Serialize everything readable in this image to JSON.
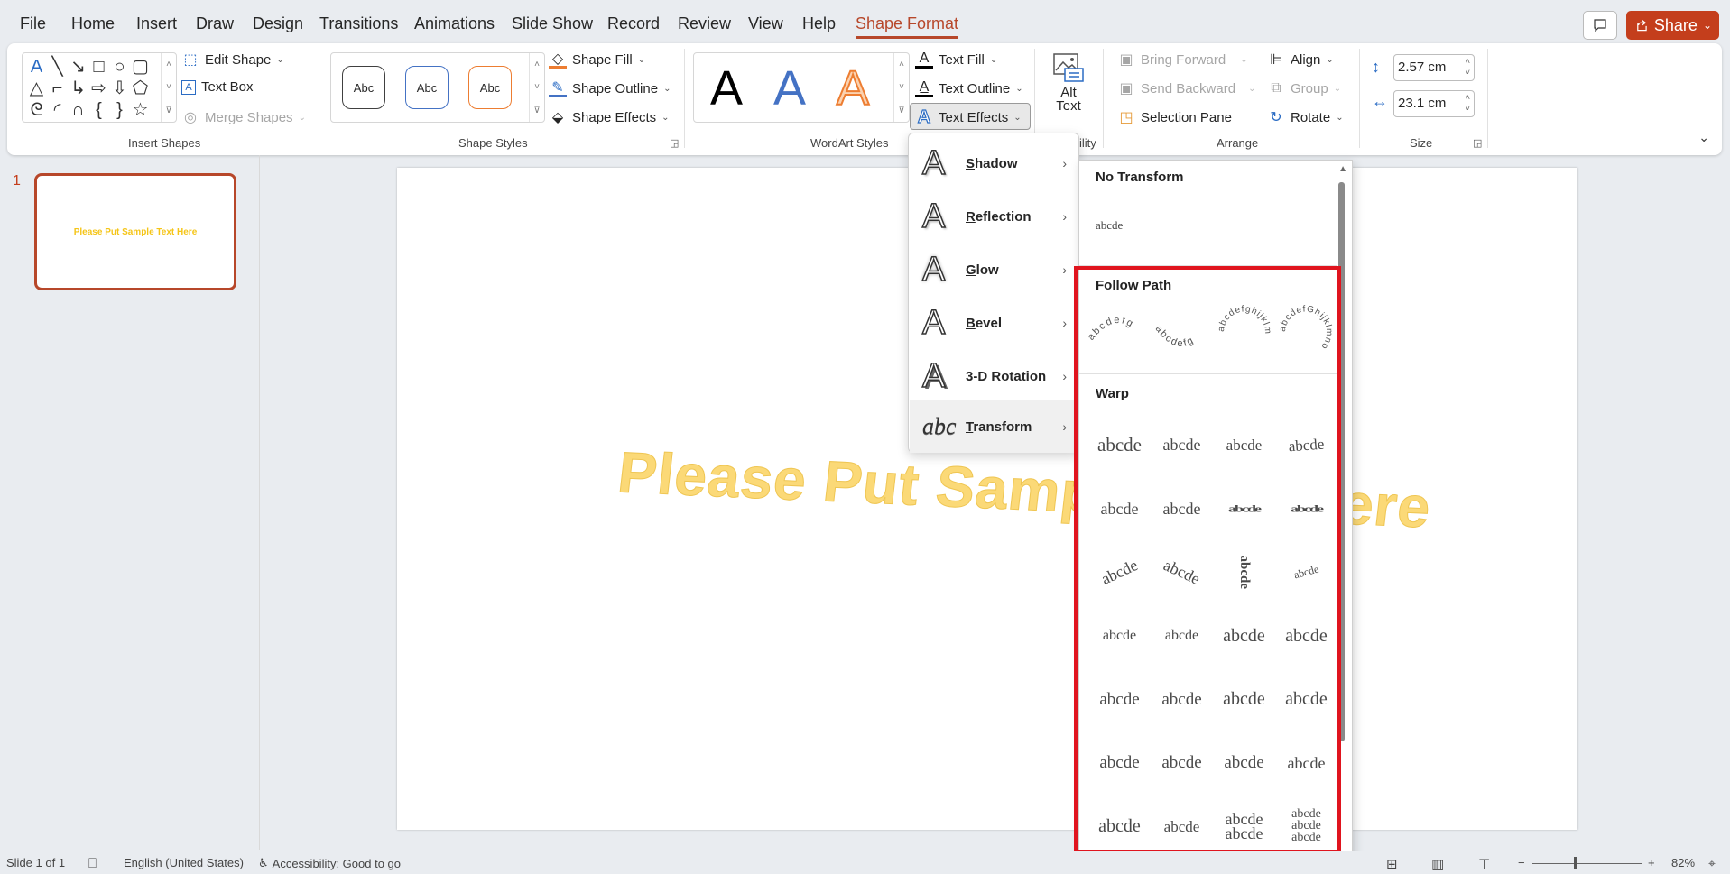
{
  "tabs": [
    {
      "label": "File"
    },
    {
      "label": "Home"
    },
    {
      "label": "Insert"
    },
    {
      "label": "Draw"
    },
    {
      "label": "Design"
    },
    {
      "label": "Transitions"
    },
    {
      "label": "Animations"
    },
    {
      "label": "Slide Show"
    },
    {
      "label": "Record"
    },
    {
      "label": "Review"
    },
    {
      "label": "View"
    },
    {
      "label": "Help"
    },
    {
      "label": "Shape Format",
      "active": true
    }
  ],
  "header": {
    "share_label": "Share",
    "comment_icon": "comment-icon"
  },
  "ribbon": {
    "insert_shapes": {
      "label": "Insert Shapes",
      "shapes": [
        "A",
        "╲",
        "↘",
        "□",
        "○",
        "▢",
        "△",
        "⌐",
        "↳",
        "⇨",
        "⇩",
        "⬠",
        "ᘓ",
        "◜",
        "∩",
        "{",
        "}",
        "☆"
      ],
      "edit_shape": "Edit Shape",
      "text_box": "Text Box",
      "merge_shapes": "Merge Shapes"
    },
    "shape_styles": {
      "label": "Shape Styles",
      "samples": [
        {
          "text": "Abc",
          "color": "#404040"
        },
        {
          "text": "Abc",
          "color": "#4472c4"
        },
        {
          "text": "Abc",
          "color": "#ed7d31"
        }
      ],
      "shape_fill": "Shape Fill",
      "shape_outline": "Shape Outline",
      "shape_effects": "Shape Effects"
    },
    "wordart_styles": {
      "label": "WordArt Styles",
      "samples": [
        {
          "text": "A",
          "color": "#000000"
        },
        {
          "text": "A",
          "color": "#4472c4"
        },
        {
          "text": "A",
          "color": "#f4b183"
        }
      ],
      "text_fill": "Text Fill",
      "text_outline": "Text Outline",
      "text_effects": "Text Effects"
    },
    "accessibility": {
      "label": "ility",
      "alt_text_line1": "Alt",
      "alt_text_line2": "Text"
    },
    "arrange": {
      "label": "Arrange",
      "bring_forward": "Bring Forward",
      "send_backward": "Send Backward",
      "selection_pane": "Selection Pane",
      "align": "Align",
      "group": "Group",
      "rotate": "Rotate"
    },
    "size": {
      "label": "Size",
      "height": "2.57 cm",
      "width": "23.1 cm"
    }
  },
  "thumbnails": [
    {
      "number": "1",
      "text": "Please Put Sample Text Here"
    }
  ],
  "slide": {
    "text": "Please Put Sample Text Here"
  },
  "text_effects_menu": {
    "items": [
      {
        "label": "Shadow",
        "access_key": "S",
        "rest": "hadow"
      },
      {
        "label": "Reflection",
        "access_key": "R",
        "rest": "eflection"
      },
      {
        "label": "Glow",
        "access_key": "G",
        "rest": "low"
      },
      {
        "label": "Bevel",
        "access_key": "B",
        "rest": "evel"
      },
      {
        "label": "3-D Rotation",
        "prefix": "3-",
        "access_key": "D",
        "rest": " Rotation"
      },
      {
        "label": "Transform",
        "access_key": "T",
        "rest": "ransform",
        "active": true
      }
    ]
  },
  "transform_gallery": {
    "no_transform": {
      "heading": "No Transform",
      "sample": "abcde"
    },
    "follow_path": {
      "heading": "Follow Path",
      "samples": [
        "abcdefg",
        "abcdefg",
        "abcdefghijklm",
        "abcdefGhijklmno"
      ]
    },
    "warp": {
      "heading": "Warp",
      "samples": [
        "abcde",
        "abcde",
        "abcde",
        "abcde",
        "abcde",
        "abcde",
        "abcde",
        "abcde",
        "abcde",
        "abcde",
        "abcde",
        "abcde",
        "abcde",
        "abcde",
        "abcde",
        "abcde",
        "abcde",
        "abcde",
        "abcde",
        "abcde",
        "abcde",
        "abcde",
        "abcde",
        "abcde",
        "abcde",
        "abcde",
        "abcde abcde",
        "abcde abcde abcde"
      ]
    },
    "highlight_color": "#e0141e"
  },
  "status_bar": {
    "slide_counter": "Slide 1 of 1",
    "language": "English (United States)",
    "accessibility": "Accessibility: Good to go",
    "zoom": "82%"
  },
  "colors": {
    "accent": "#b7472a",
    "share": "#c43e1c",
    "wordart_yellow": "#fbd977"
  }
}
